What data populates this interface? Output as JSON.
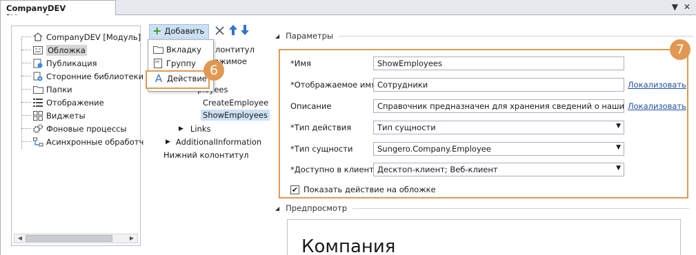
{
  "window": {
    "tab_title": "CompanyDEV [Модуль]",
    "controls": [
      "▼",
      "✕"
    ]
  },
  "left_tree": {
    "items": [
      {
        "label": "CompanyDEV [Модуль]",
        "icon": "home-icon"
      },
      {
        "label": "Обложка",
        "icon": "cover-icon",
        "selected": true
      },
      {
        "label": "Публикация",
        "icon": "publish-icon"
      },
      {
        "label": "Сторонние библиотеки",
        "icon": "libraries-icon"
      },
      {
        "label": "Папки",
        "icon": "folder-icon"
      },
      {
        "label": "Отображение",
        "icon": "list-icon"
      },
      {
        "label": "Виджеты",
        "icon": "widgets-icon"
      },
      {
        "label": "Фоновые процессы",
        "icon": "gears-icon"
      },
      {
        "label": "Асинхронные обработч",
        "icon": "async-icon"
      }
    ]
  },
  "toolbar": {
    "add_label": "Добавить",
    "delete_icon": "close-icon",
    "up_icon": "arrow-up-icon",
    "down_icon": "arrow-down-icon"
  },
  "add_menu": {
    "items": [
      {
        "label": "Вкладку",
        "icon": "tab-icon"
      },
      {
        "label": "Группу",
        "icon": "group-icon"
      },
      {
        "label": "Действие",
        "icon": "action-icon",
        "highlighted": true
      }
    ]
  },
  "middle_tree": {
    "partial_1": "лонтитул",
    "partial_2": "ржимое",
    "partial_3": "ployees",
    "items": {
      "create_employee": "CreateEmployee",
      "show_employees": "ShowEmployees",
      "links": "Links",
      "additional_information": "AdditionalInformation",
      "footer": "Нижний колонтитул"
    }
  },
  "callouts": {
    "menu_number": "6",
    "params_number": "7"
  },
  "parameters": {
    "section_title": "Параметры",
    "name_label": "*Имя",
    "name_value": "ShowEmployees",
    "display_name_label": "*Отображаемое имя",
    "display_name_value": "Сотрудники",
    "localize_link_1": "Локализовать",
    "description_label": "Описание",
    "description_value": "Справочник предназначен для хранения сведений о наших сотр",
    "localize_link_2": "Локализовать",
    "action_type_label": "*Тип действия",
    "action_type_value": "Тип сущности",
    "entity_type_label": "*Тип сущности",
    "entity_type_value": "Sungero.Company.Employee",
    "clients_label": "*Доступно в клиентах",
    "clients_value": "Десктоп-клиент; Веб-клиент",
    "show_on_cover_label": "Показать действие на обложке",
    "show_on_cover_checked": true
  },
  "preview": {
    "section_title": "Предпросмотр",
    "title": "Компания"
  },
  "colors": {
    "callout": "#e09852",
    "selection": "#cde1f5",
    "link": "#1f4fa8"
  }
}
